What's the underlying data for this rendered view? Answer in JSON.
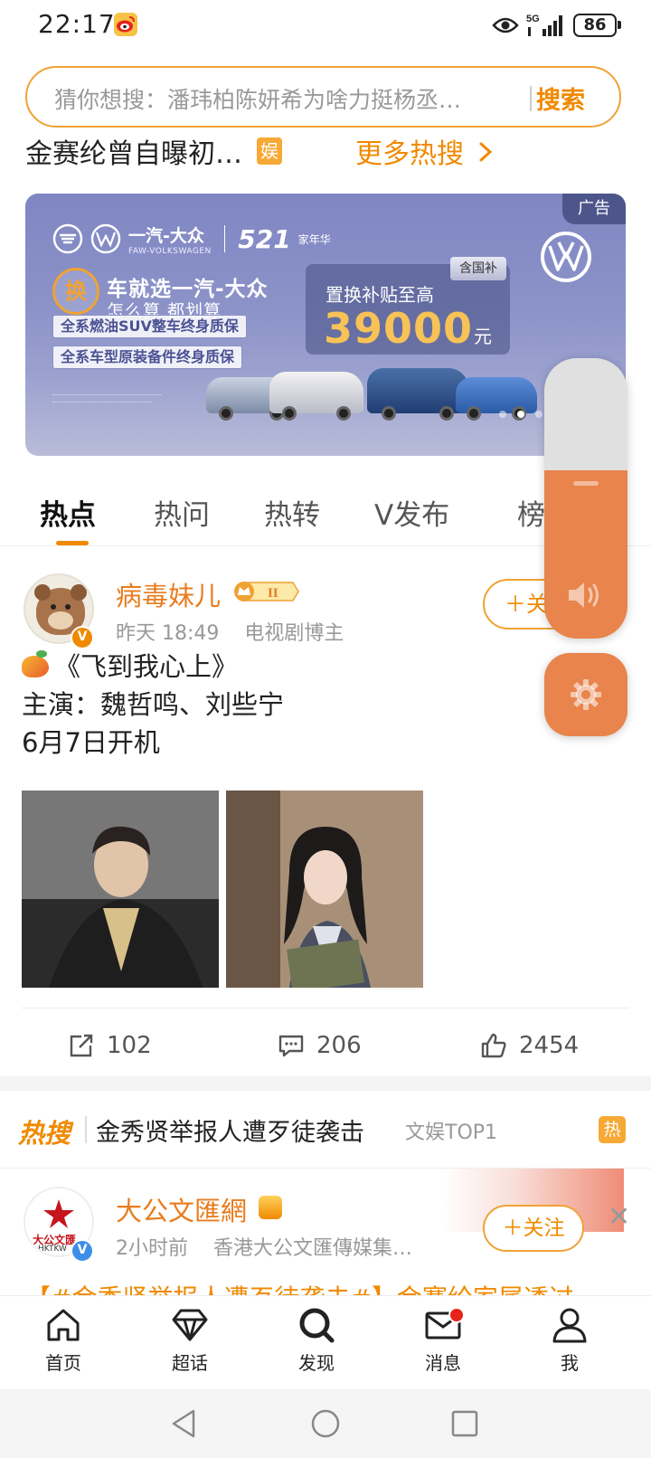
{
  "status_bar": {
    "time": "22:17",
    "network": "5G",
    "battery": "86"
  },
  "search": {
    "placeholder": "猜你想搜：潘玮柏陈妍希为啥力挺杨丞…",
    "button_label": "搜索"
  },
  "hot_row": {
    "title": "金赛纶曾自曝初…",
    "badge": "娱",
    "more_label": "更多热搜"
  },
  "ad": {
    "tag": "广告",
    "brand_name": "一汽-大众",
    "brand_sub": "FAW-VOLKSWAGEN",
    "event_number": "521",
    "event_name": "家年华",
    "swap_char": "换",
    "headline": "车就选一汽-大众",
    "subline": "怎么算 都划算",
    "pill_1": "全系燃油SUV整车终身质保",
    "pill_2": "全系车型原装备件终身质保",
    "subsidy_tag": "含国补",
    "subsidy_label": "置换补贴至高",
    "subsidy_amount": "39000",
    "subsidy_unit": "元",
    "carousel_active_index": 1,
    "carousel_total": 3
  },
  "volume": {
    "level": 0.6
  },
  "tabs": [
    {
      "label": "热点",
      "active": true
    },
    {
      "label": "热问",
      "active": false
    },
    {
      "label": "热转",
      "active": false
    },
    {
      "label": "V发布",
      "active": false
    },
    {
      "label": "榜",
      "active": false
    }
  ],
  "post": {
    "author": "病毒妹儿",
    "level": "II",
    "time": "昨天 18:49",
    "role": "电视剧博主",
    "follow_label": "＋关注",
    "line_1": "《飞到我心上》",
    "line_2": "主演：魏哲鸣、刘些宁",
    "line_3": "6月7日开机",
    "reposts": "102",
    "comments": "206",
    "likes": "2454"
  },
  "trend": {
    "brand": "热搜",
    "title": "金秀贤举报人遭歹徒袭击",
    "rank": "文娱TOP1",
    "badge": "热"
  },
  "post2": {
    "author": "大公文匯網",
    "avatar_text": "大公文匯",
    "avatar_sub": "HKTKW",
    "time": "2小时前",
    "source": "香港大公文匯傳媒集…",
    "follow_label": "＋关注",
    "snippet": "【#金秀贤举报人遭歹徒袭击#】金赛纶家属透过"
  },
  "bottom_nav": [
    {
      "label": "首页",
      "icon": "home-icon"
    },
    {
      "label": "超话",
      "icon": "diamond-icon"
    },
    {
      "label": "发现",
      "icon": "search-icon"
    },
    {
      "label": "消息",
      "icon": "mail-icon"
    },
    {
      "label": "我",
      "icon": "person-icon"
    }
  ],
  "colors": {
    "accent": "#f08a00",
    "accent_soft": "#e8844c",
    "name": "#e87c1e"
  }
}
